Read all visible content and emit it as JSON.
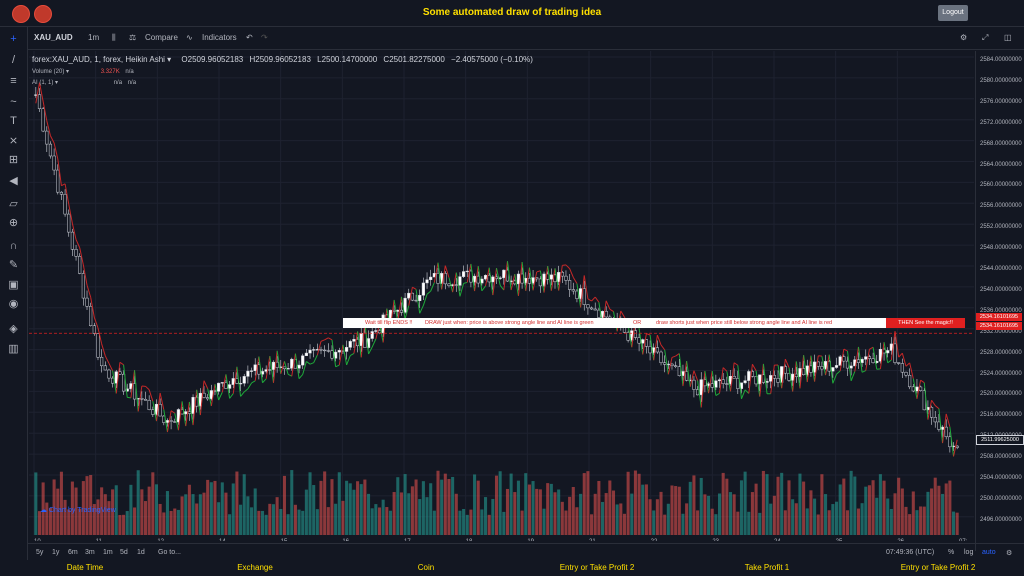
{
  "app_title": "Some automated draw of trading idea",
  "logout_label": "Logout",
  "toolbar": {
    "symbol": "XAU_AUD",
    "interval": "1m",
    "compare": "Compare",
    "indicators": "Indicators"
  },
  "legend": {
    "main": "forex:XAU_AUD, 1, forex, Heikin Ashi ▾",
    "open": "O2509.96052183",
    "high": "H2509.96052183",
    "low": "L2500.14700000",
    "close": "C2501.82275000",
    "change": "−2.40575000 (−0.10%)",
    "volume": "Volume (20) ▾",
    "volume_value": "3.327K",
    "volume_na": "n/a",
    "ai": "AI (1, 1) ▾",
    "ai_na1": "n/a",
    "ai_na2": "n/a"
  },
  "banner": {
    "part1": "Wait till flip ENDS !!",
    "part2": "DRAW just when:  price is above strong angle line and AI line is green",
    "part3": "OR",
    "part4": "draw shorts just when price still below strong angle line and AI line is red",
    "part5": "THEN See the magic!!"
  },
  "price_scale": {
    "labels": [
      "2584.00000000",
      "2580.00000000",
      "2576.00000000",
      "2572.00000000",
      "2568.00000000",
      "2564.00000000",
      "2560.00000000",
      "2556.00000000",
      "2552.00000000",
      "2548.00000000",
      "2544.00000000",
      "2540.00000000",
      "2536.00000000",
      "2532.00000000",
      "2528.00000000",
      "2524.00000000",
      "2520.00000000",
      "2516.00000000",
      "2512.00000000",
      "2508.00000000",
      "2504.00000000",
      "2500.00000000",
      "2496.00000000"
    ],
    "marker1": "2534.16101695",
    "marker2": "2534.16101695",
    "current": "2511.99625000"
  },
  "time_axis": [
    "10",
    "11",
    "12",
    "14",
    "15",
    "16",
    "17",
    "18",
    "19",
    "21",
    "22",
    "23",
    "24",
    "25",
    "26",
    "07:"
  ],
  "bottom_bar": {
    "ranges": [
      "5y",
      "1y",
      "6m",
      "3m",
      "1m",
      "5d",
      "1d"
    ],
    "goto": "Go to...",
    "clock": "07:49:36 (UTC)",
    "percent": "%",
    "log": "log",
    "auto": "auto"
  },
  "tradingview": "Chart by TradingView",
  "footer": [
    "Date Time",
    "Exchange",
    "Coin",
    "Entry or Take Profit 2",
    "Take Profit 1",
    "Entry or Take Profit 2"
  ],
  "colors": {
    "up": "#26a69a",
    "down": "#ef5350",
    "ai_green": "#1faa3a",
    "ai_red": "#c62828",
    "accent": "#ffe000"
  },
  "chart_data": {
    "type": "candlestick",
    "symbol": "XAU_AUD",
    "x": [
      "10",
      "11",
      "12",
      "14",
      "15",
      "16",
      "17",
      "18",
      "19",
      "21",
      "22",
      "23",
      "24",
      "25",
      "26"
    ],
    "close": [
      2578,
      2528,
      2518,
      2526,
      2529,
      2533,
      2544,
      2545,
      2544,
      2534,
      2524,
      2526,
      2528,
      2531,
      2512
    ],
    "ylim": [
      2496,
      2586
    ],
    "hline": 2534.16101695
  }
}
